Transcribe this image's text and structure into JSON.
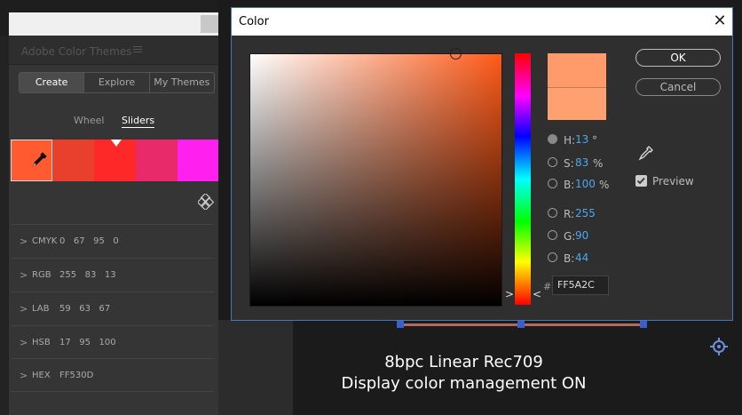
{
  "left_panel": {
    "title": "Adobe Color Themes",
    "tabs": [
      {
        "label": "Create",
        "active": true
      },
      {
        "label": "Explore",
        "active": false
      },
      {
        "label": "My Themes",
        "active": false
      }
    ],
    "modes": {
      "wheel": "Wheel",
      "sliders": "Sliders"
    },
    "swatch_colors": [
      "#ff5a30",
      "#e8402c",
      "#ff2828",
      "#e82a6a",
      "#ff20f0"
    ],
    "color_modes": [
      {
        "label": "CMYK",
        "value": "0   67   95   0"
      },
      {
        "label": "RGB",
        "value": "255   83   13"
      },
      {
        "label": "LAB",
        "value": "59   63   67"
      },
      {
        "label": "HSB",
        "value": "17   95   100"
      },
      {
        "label": "HEX",
        "value": "FF530D"
      }
    ]
  },
  "dialog": {
    "title": "Color",
    "close_glyph": "✕",
    "hsb": {
      "h": {
        "label": "H:",
        "value": "13",
        "unit": "°"
      },
      "s": {
        "label": "S:",
        "value": "83",
        "unit": "%"
      },
      "b": {
        "label": "B:",
        "value": "100",
        "unit": "%"
      }
    },
    "rgb": {
      "r": {
        "label": "R:",
        "value": "255"
      },
      "g": {
        "label": "G:",
        "value": "90"
      },
      "b": {
        "label": "B:",
        "value": "44"
      }
    },
    "hex_hash": "#",
    "hex": "FF5A2C",
    "ok_label": "OK",
    "cancel_label": "Cancel",
    "preview_label": "Preview",
    "preview_checked": true,
    "new_color": "#ff9a6a",
    "current_color": "#ffa070"
  },
  "canvas": {
    "caption_line1": "8bpc Linear Rec709",
    "caption_line2": "Display color management ON"
  }
}
